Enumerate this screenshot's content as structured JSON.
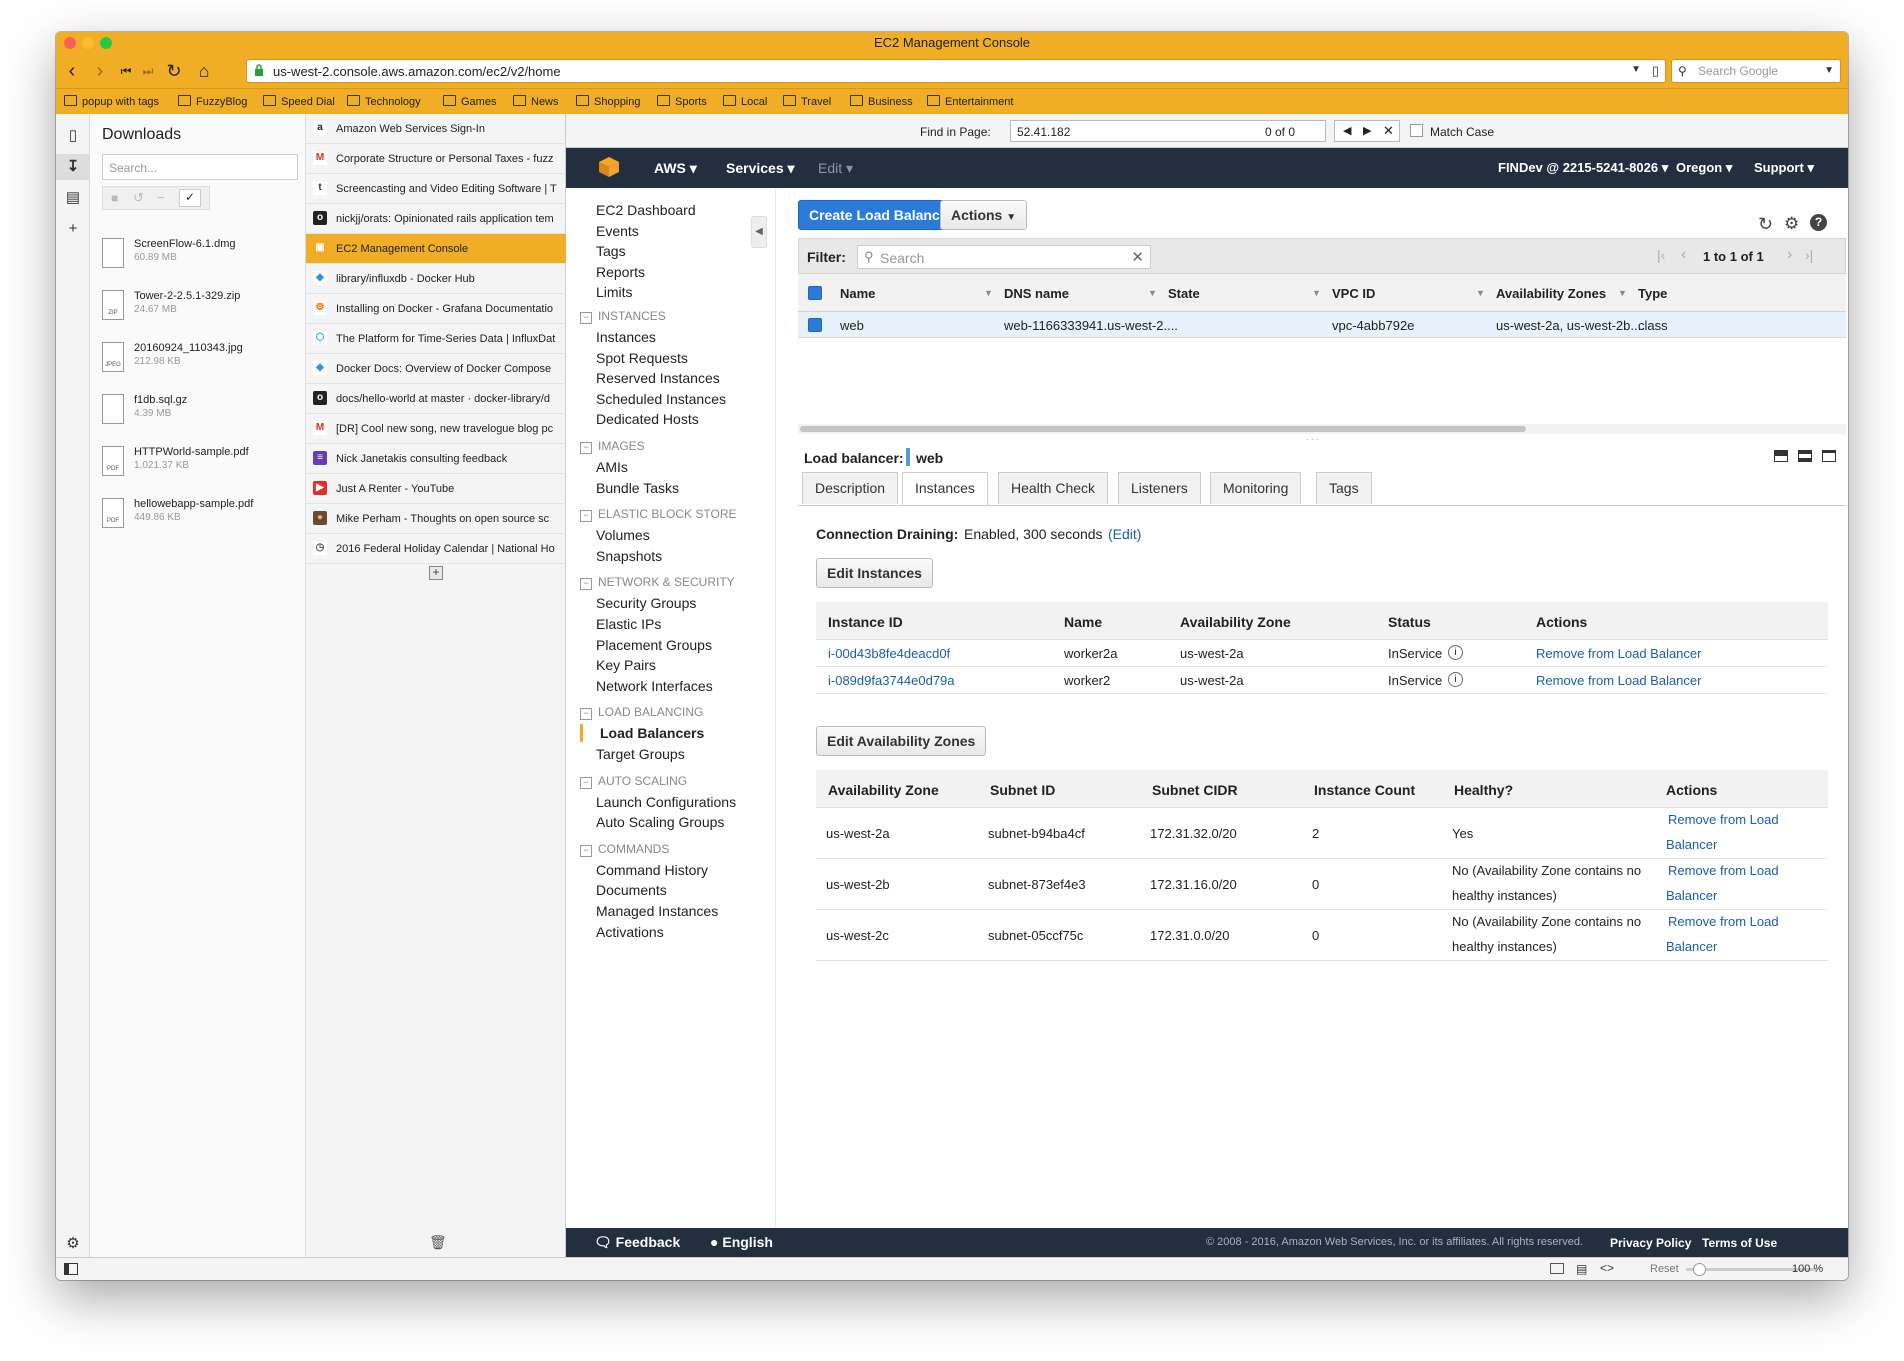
{
  "window": {
    "title": "EC2 Management Console"
  },
  "browser": {
    "url": "us-west-2.console.aws.amazon.com/ec2/v2/home",
    "search_placeholder": "Search Google"
  },
  "bookmarks": [
    "popup with tags",
    "FuzzyBlog",
    "Speed Dial",
    "Technology",
    "Games",
    "News",
    "Shopping",
    "Sports",
    "Local",
    "Travel",
    "Business",
    "Entertainment"
  ],
  "downloads": {
    "title": "Downloads",
    "search_placeholder": "Search...",
    "items": [
      {
        "name": "ScreenFlow-6.1.dmg",
        "size": "60.89 MB",
        "type": ""
      },
      {
        "name": "Tower-2-2.5.1-329.zip",
        "size": "24.67 MB",
        "type": "ZIP"
      },
      {
        "name": "20160924_110343.jpg",
        "size": "212.98 KB",
        "type": "JPEG"
      },
      {
        "name": "f1db.sql.gz",
        "size": "4.39 MB",
        "type": ""
      },
      {
        "name": "HTTPWorld-sample.pdf",
        "size": "1,021.37 KB",
        "type": "PDF"
      },
      {
        "name": "hellowebapp-sample.pdf",
        "size": "449.86 KB",
        "type": "PDF"
      }
    ]
  },
  "tabs": [
    {
      "label": "Amazon Web Services Sign-In",
      "icon": "amazon-icon",
      "color": "#ffffff",
      "glyph": "a",
      "glyph_color": "#222222"
    },
    {
      "label": "Corporate Structure or Personal Taxes - fuzz",
      "icon": "gmail-icon",
      "color": "#ffffff",
      "glyph": "M",
      "glyph_color": "#d93025"
    },
    {
      "label": "Screencasting and Video Editing Software | T",
      "icon": "techsmith-icon",
      "color": "#ffffff",
      "glyph": "t",
      "glyph_color": "#1a3a6a"
    },
    {
      "label": "nickjj/orats: Opinionated rails application tem",
      "icon": "github-icon",
      "color": "#222222",
      "glyph": "o",
      "glyph_color": "#ffffff"
    },
    {
      "label": "EC2 Management Console",
      "icon": "aws-icon",
      "color": "#f7a823",
      "glyph": "▣",
      "glyph_color": "#ffffff"
    },
    {
      "label": "library/influxdb - Docker Hub",
      "icon": "docker-icon",
      "color": "#ffffff",
      "glyph": "◆",
      "glyph_color": "#2496ed"
    },
    {
      "label": "Installing on Docker - Grafana Documentatio",
      "icon": "grafana-icon",
      "color": "#ffffff",
      "glyph": "⚙",
      "glyph_color": "#f46800"
    },
    {
      "label": "The Platform for Time-Series Data | InfluxDat",
      "icon": "influx-icon",
      "color": "#ffffff",
      "glyph": "⬡",
      "glyph_color": "#22adf6"
    },
    {
      "label": "Docker Docs: Overview of Docker Compose",
      "icon": "docker-icon",
      "color": "#ffffff",
      "glyph": "◆",
      "glyph_color": "#2496ed"
    },
    {
      "label": "docs/hello-world at master · docker-library/d",
      "icon": "github-icon",
      "color": "#222222",
      "glyph": "o",
      "glyph_color": "#ffffff"
    },
    {
      "label": "[DR] Cool new song, new travelogue blog pc",
      "icon": "gmail-icon",
      "color": "#ffffff",
      "glyph": "M",
      "glyph_color": "#d93025"
    },
    {
      "label": "Nick Janetakis consulting feedback",
      "icon": "form-icon",
      "color": "#673ab7",
      "glyph": "≡",
      "glyph_color": "#ffffff"
    },
    {
      "label": "Just A Renter - YouTube",
      "icon": "youtube-icon",
      "color": "#e52d27",
      "glyph": "▶",
      "glyph_color": "#ffffff"
    },
    {
      "label": "Mike Perham - Thoughts on open source sc",
      "icon": "avatar-icon",
      "color": "#6b4a32",
      "glyph": "●",
      "glyph_color": "#d8b08a"
    },
    {
      "label": "2016 Federal Holiday Calendar | National Ho",
      "icon": "clock-icon",
      "color": "#ffffff",
      "glyph": "◷",
      "glyph_color": "#555555"
    }
  ],
  "find": {
    "label": "Find in Page:",
    "query": "52.41.182",
    "count": "0 of 0",
    "match_case": "Match Case"
  },
  "aws_nav": {
    "aws": "AWS",
    "services": "Services",
    "edit": "Edit",
    "account": "FINDev @ 2215-5241-8026",
    "region": "Oregon",
    "support": "Support"
  },
  "sidebar": {
    "top": [
      "EC2 Dashboard",
      "Events",
      "Tags",
      "Reports",
      "Limits"
    ],
    "sections": [
      {
        "header": "INSTANCES",
        "items": [
          "Instances",
          "Spot Requests",
          "Reserved Instances",
          "Scheduled Instances",
          "Dedicated Hosts"
        ]
      },
      {
        "header": "IMAGES",
        "items": [
          "AMIs",
          "Bundle Tasks"
        ]
      },
      {
        "header": "ELASTIC BLOCK STORE",
        "items": [
          "Volumes",
          "Snapshots"
        ]
      },
      {
        "header": "NETWORK & SECURITY",
        "items": [
          "Security Groups",
          "Elastic IPs",
          "Placement Groups",
          "Key Pairs",
          "Network Interfaces"
        ]
      },
      {
        "header": "LOAD BALANCING",
        "items": [
          "Load Balancers",
          "Target Groups"
        ]
      },
      {
        "header": "AUTO SCALING",
        "items": [
          "Launch Configurations",
          "Auto Scaling Groups"
        ]
      },
      {
        "header": "COMMANDS",
        "items": [
          "Command History",
          "Documents",
          "Managed Instances",
          "Activations"
        ]
      }
    ],
    "selected": "Load Balancers"
  },
  "toolbar": {
    "create": "Create Load Balancer",
    "actions": "Actions"
  },
  "filter": {
    "label": "Filter:",
    "placeholder": "Search",
    "paging": "1 to 1 of 1"
  },
  "lb_table": {
    "headers": [
      "Name",
      "DNS name",
      "State",
      "VPC ID",
      "Availability Zones",
      "Type"
    ],
    "rows": [
      [
        "web",
        "web-1166333941.us-west-2....",
        "",
        "vpc-4abb792e",
        "us-west-2a, us-west-2b....",
        "class"
      ]
    ]
  },
  "detail": {
    "label": "Load balancer:",
    "name": "web",
    "tabs": [
      "Description",
      "Instances",
      "Health Check",
      "Listeners",
      "Monitoring",
      "Tags"
    ],
    "active_tab": "Instances",
    "draining_label": "Connection Draining:",
    "draining_value": "Enabled, 300 seconds",
    "draining_edit": "(Edit)",
    "edit_instances": "Edit Instances",
    "instances_headers": [
      "Instance ID",
      "Name",
      "Availability Zone",
      "Status",
      "Actions"
    ],
    "instances": [
      {
        "id": "i-00d43b8fe4deacd0f",
        "name": "worker2a",
        "az": "us-west-2a",
        "status": "InService",
        "action": "Remove from Load Balancer"
      },
      {
        "id": "i-089d9fa3744e0d79a",
        "name": "worker2",
        "az": "us-west-2a",
        "status": "InService",
        "action": "Remove from Load Balancer"
      }
    ],
    "edit_az": "Edit Availability Zones",
    "az_headers": [
      "Availability Zone",
      "Subnet ID",
      "Subnet CIDR",
      "Instance Count",
      "Healthy?",
      "Actions"
    ],
    "azs": [
      {
        "az": "us-west-2a",
        "subnet": "subnet-b94ba4cf",
        "cidr": "172.31.32.0/20",
        "count": "2",
        "healthy1": "Yes",
        "healthy2": "",
        "action1": "Remove from Load",
        "action2": "Balancer"
      },
      {
        "az": "us-west-2b",
        "subnet": "subnet-873ef4e3",
        "cidr": "172.31.16.0/20",
        "count": "0",
        "healthy1": "No (Availability Zone contains no",
        "healthy2": "healthy instances)",
        "action1": "Remove from Load",
        "action2": "Balancer"
      },
      {
        "az": "us-west-2c",
        "subnet": "subnet-05ccf75c",
        "cidr": "172.31.0.0/20",
        "count": "0",
        "healthy1": "No (Availability Zone contains no",
        "healthy2": "healthy instances)",
        "action1": "Remove from Load",
        "action2": "Balancer"
      }
    ]
  },
  "footer": {
    "feedback": "Feedback",
    "language": "English",
    "copyright": "© 2008 - 2016, Amazon Web Services, Inc. or its affiliates. All rights reserved.",
    "privacy": "Privacy Policy",
    "terms": "Terms of Use"
  },
  "status": {
    "reset": "Reset",
    "zoom": "100 %",
    "zoom_level": 0.1
  },
  "colors": {
    "browser_accent": "#f0ad26",
    "aws_nav": "#232f3e",
    "primary_button": "#2b7bd9",
    "link": "#1a5ead"
  }
}
